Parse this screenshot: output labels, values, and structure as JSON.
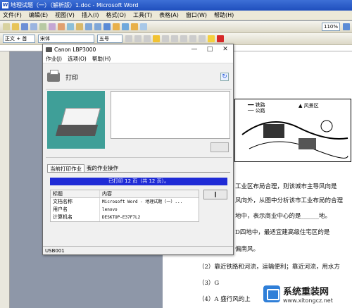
{
  "word": {
    "title": "地理试题（一）（解析版）1.doc - Microsoft Word",
    "menu": [
      "文件(F)",
      "编辑(E)",
      "视图(V)",
      "插入(I)",
      "格式(O)",
      "工具(T)",
      "表格(A)",
      "窗口(W)",
      "帮助(H)"
    ],
    "style_combo": "正文 + 首",
    "font_combo": "宋体",
    "size_combo": "五号",
    "zoom": "110%",
    "doc_lines": [
      "工业区布局合理，则该城市主导风向是",
      "风向外，从图中分析该市工业布局的合理",
      "地中，表示商业中心的是______地。",
      "D四地中，最适宜建高级住宅区的是",
      "偏南风。",
      "（2）靠近铁路和河流，运输便利；靠近河流，用水方",
      "（3）G",
      "（4）A   盛行风的上"
    ],
    "map_legend": [
      "铁路",
      "公路"
    ],
    "map_legend2": "风景区"
  },
  "dialog": {
    "title": "Canon LBP3000",
    "menu": [
      "作业(J)",
      "选项(O)",
      "帮助(H)"
    ],
    "header": "打印",
    "tabs": [
      "当前打印作业",
      "我的作业操作"
    ],
    "progress_text": "已打印 12 页（共 12 页）。",
    "table_headers": [
      "标题",
      "内容"
    ],
    "rows": [
      {
        "k": "文档名称",
        "v": "Microsoft Word - 地理试题（一）..."
      },
      {
        "k": "用户名",
        "v": "lenovo"
      },
      {
        "k": "计算机名",
        "v": "DESKTOP-E37F7L2"
      }
    ],
    "status": "USB001"
  },
  "watermark": {
    "title": "系统重装网",
    "url": "www.xitongcz.net"
  }
}
